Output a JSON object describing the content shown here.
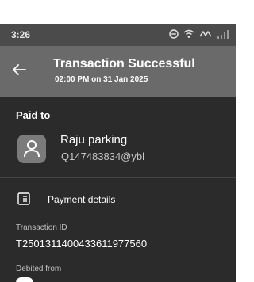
{
  "status_bar": {
    "time": "3:26",
    "icons": [
      "dnd-icon",
      "wifi-icon",
      "vowifi-icon",
      "signal-icon"
    ]
  },
  "header": {
    "title": "Transaction Successful",
    "subtitle": "02:00 PM on 31 Jan 2025"
  },
  "paid_to": {
    "label": "Paid to",
    "name": "Raju parking",
    "vpa": "Q147483834@ybl"
  },
  "payment_details": {
    "label": "Payment details"
  },
  "transaction": {
    "id_label": "Transaction ID",
    "id_value": "T2501311400433611977560"
  },
  "debited": {
    "label": "Debited from"
  },
  "colors": {
    "status_bar_bg": "#4b4b4b",
    "header_bg": "#6a6a6a",
    "content_bg": "#2b2b2b",
    "avatar_bg": "#7b7b7b"
  }
}
